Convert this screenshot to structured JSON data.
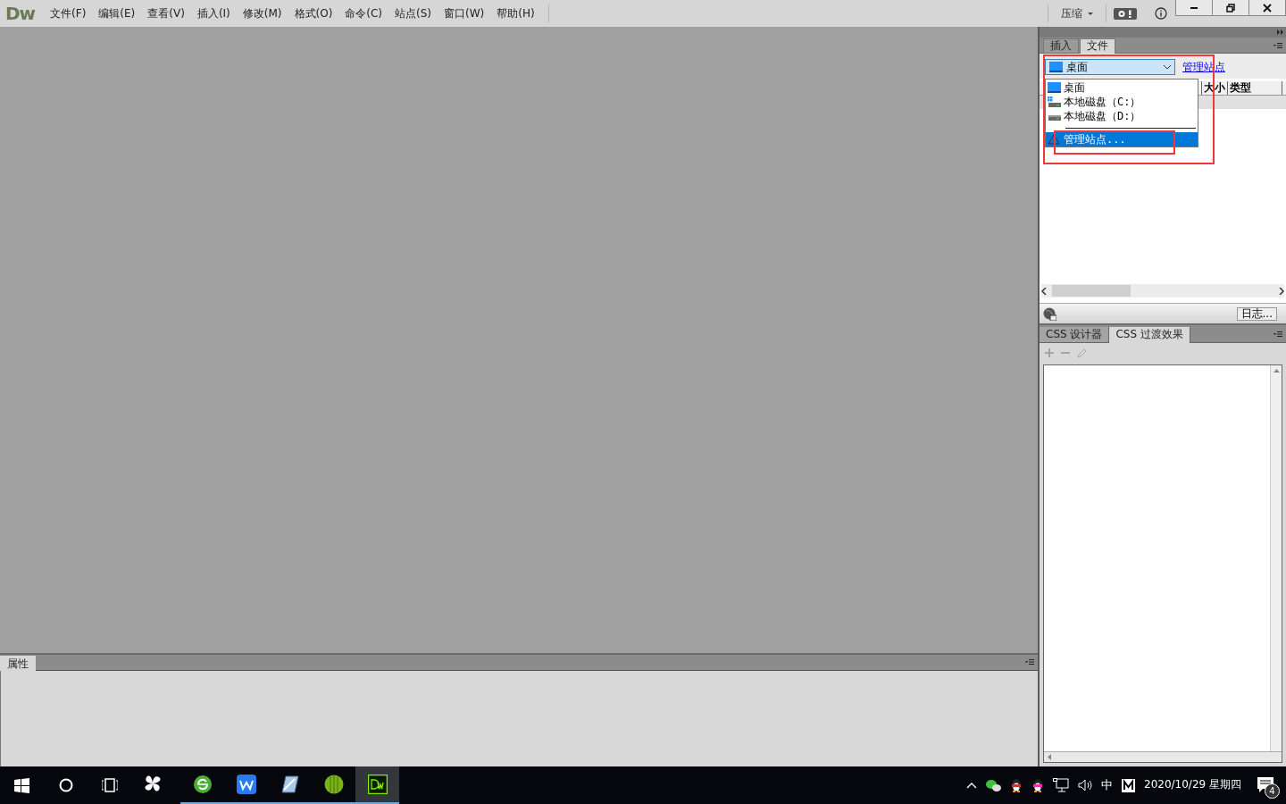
{
  "app": {
    "logo": "Dw"
  },
  "menu": [
    {
      "label": "文件(F)"
    },
    {
      "label": "编辑(E)"
    },
    {
      "label": "查看(V)"
    },
    {
      "label": "插入(I)"
    },
    {
      "label": "修改(M)"
    },
    {
      "label": "格式(O)"
    },
    {
      "label": "命令(C)"
    },
    {
      "label": "站点(S)"
    },
    {
      "label": "窗口(W)"
    },
    {
      "label": "帮助(H)"
    }
  ],
  "workspace": {
    "label": "压缩"
  },
  "files_panel": {
    "tabs": [
      {
        "label": "插入",
        "selected": false
      },
      {
        "label": "文件",
        "selected": true
      }
    ],
    "location": "桌面",
    "manage_link": "管理站点",
    "columns": [
      "大小",
      "类型"
    ],
    "dropdown": [
      {
        "kind": "desktop",
        "label": "桌面",
        "selected": false
      },
      {
        "kind": "drive-system",
        "label": "本地磁盘（C:）",
        "selected": false
      },
      {
        "kind": "drive",
        "label": "本地磁盘（D:）",
        "selected": false
      },
      {
        "kind": "separator",
        "selected": false
      },
      {
        "kind": "site",
        "label": "管理站点...",
        "selected": true
      }
    ],
    "log_button": "日志..."
  },
  "css_panel": {
    "tabs": [
      {
        "label": "CSS 设计器",
        "selected": false
      },
      {
        "label": "CSS 过渡效果",
        "selected": true
      }
    ]
  },
  "properties_panel": {
    "tab": "属性"
  },
  "taskbar": {
    "apps": [
      {
        "kind": "fan",
        "running": false,
        "selected": false
      },
      {
        "kind": "refresh",
        "running": true,
        "selected": false
      },
      {
        "kind": "wps",
        "running": true,
        "selected": false
      },
      {
        "kind": "notepad",
        "running": true,
        "selected": false
      },
      {
        "kind": "ball",
        "running": true,
        "selected": false
      },
      {
        "kind": "dw",
        "running": true,
        "selected": true
      }
    ],
    "ime": "中",
    "date": "2020/10/29 星期四",
    "notifications": "4"
  }
}
